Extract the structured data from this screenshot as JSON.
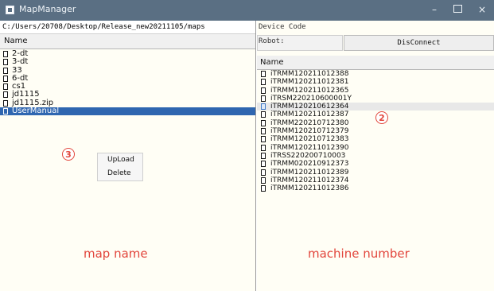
{
  "window": {
    "title": "MapManager",
    "min": "–",
    "close": "×"
  },
  "left": {
    "path": "C:/Users/20708/Desktop/Release_new20211105/maps",
    "header": "Name",
    "items": [
      "2-dt",
      "3-dt",
      "33",
      "6-dt",
      "cs1",
      "jd1115",
      "jd1115.zip",
      "UserManual"
    ]
  },
  "context_menu": {
    "items": [
      "UpLoad",
      "Delete"
    ]
  },
  "right": {
    "device_code_label": "Device Code",
    "robot_label": "Robot:",
    "disconnect_label": "DisConnect",
    "header": "Name",
    "items": [
      "iTRMM120211012388",
      "iTRMM120211012381",
      "iTRMM120211012365",
      "iTRSM220210600001Y",
      "iTRMM120210612364",
      "iTRMM120211012387",
      "iTRMM220210712380",
      "iTRMM120210712379",
      "iTRMM120210712383",
      "iTRMM120211012390",
      "iTRSS220200710003",
      "iTRMM020210912373",
      "iTRMM120211012389",
      "iTRMM120211012374",
      "iTRMM120211012386"
    ]
  },
  "annotations": {
    "map_name": "map name",
    "machine_number": "machine number",
    "marker_2": "2",
    "marker_3": "3",
    "color": "#e2463c"
  }
}
